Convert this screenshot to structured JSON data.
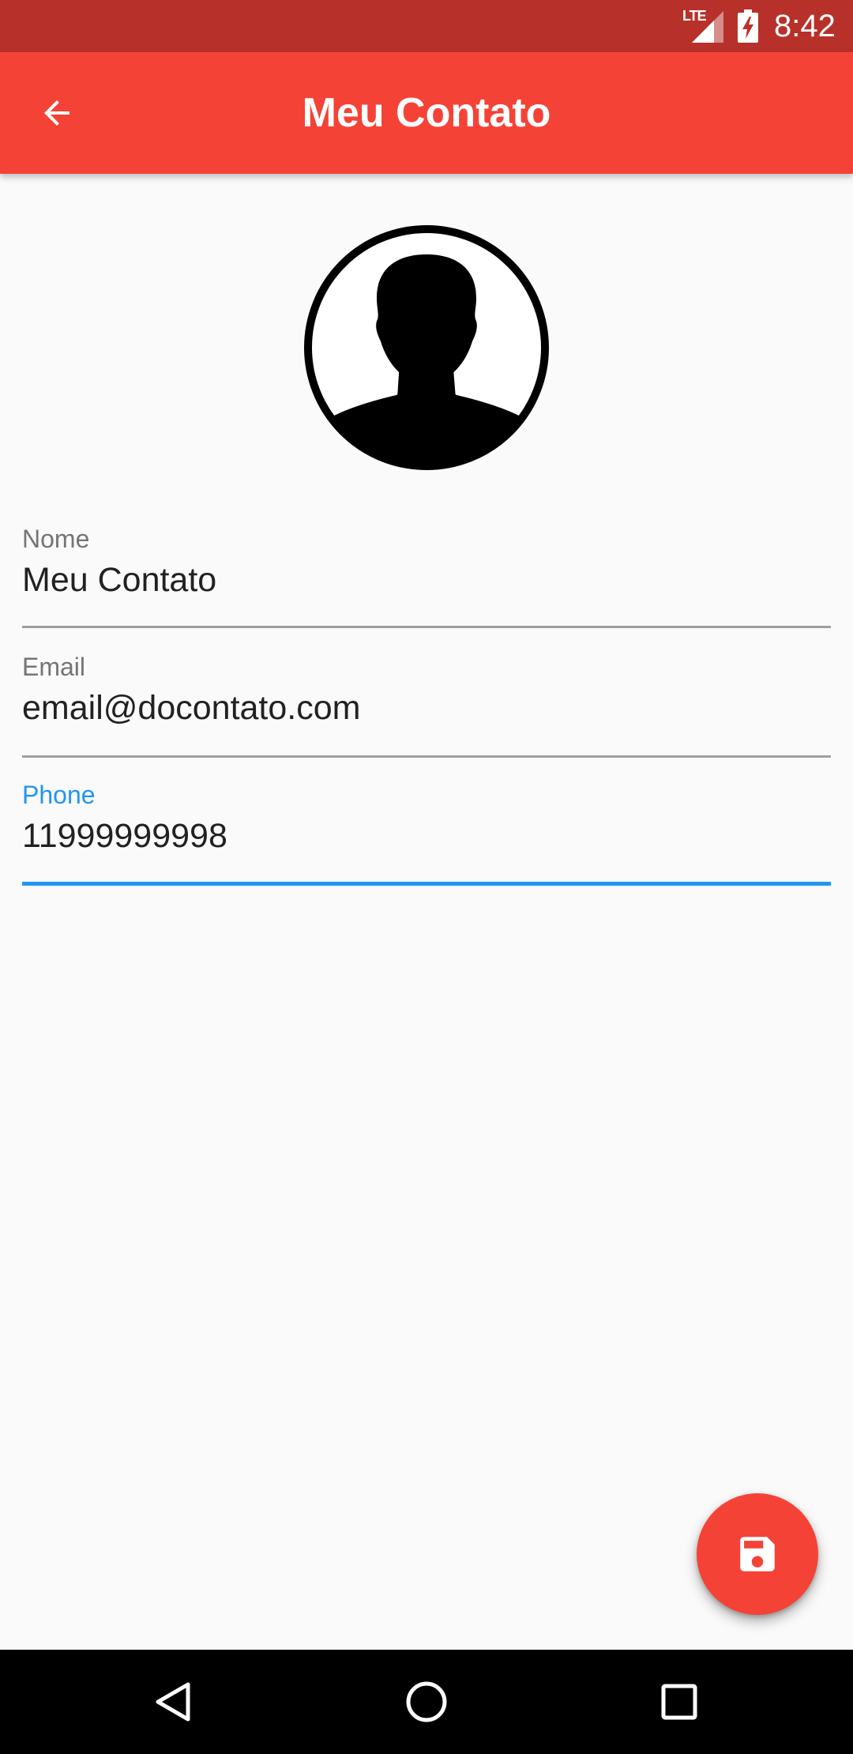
{
  "status_bar": {
    "network": "LTE",
    "time": "8:42"
  },
  "app_bar": {
    "title": "Meu Contato",
    "back_icon": "arrow-back-icon"
  },
  "avatar": {
    "icon": "person-silhouette-icon"
  },
  "form": {
    "fields": [
      {
        "label": "Nome",
        "value": "Meu Contato",
        "focused": false
      },
      {
        "label": "Email",
        "value": "email@docontato.com",
        "focused": false
      },
      {
        "label": "Phone",
        "value": "11999999998",
        "focused": true
      }
    ]
  },
  "fab": {
    "icon": "save-icon"
  },
  "nav_bar": {
    "buttons": [
      "back-triangle-icon",
      "home-circle-icon",
      "recents-square-icon"
    ]
  },
  "colors": {
    "status_bar": "#b7312a",
    "app_bar": "#f44336",
    "accent_focus": "#2196f3",
    "background": "#fafafa",
    "label_gray": "#757575",
    "text_dark": "#212121"
  }
}
